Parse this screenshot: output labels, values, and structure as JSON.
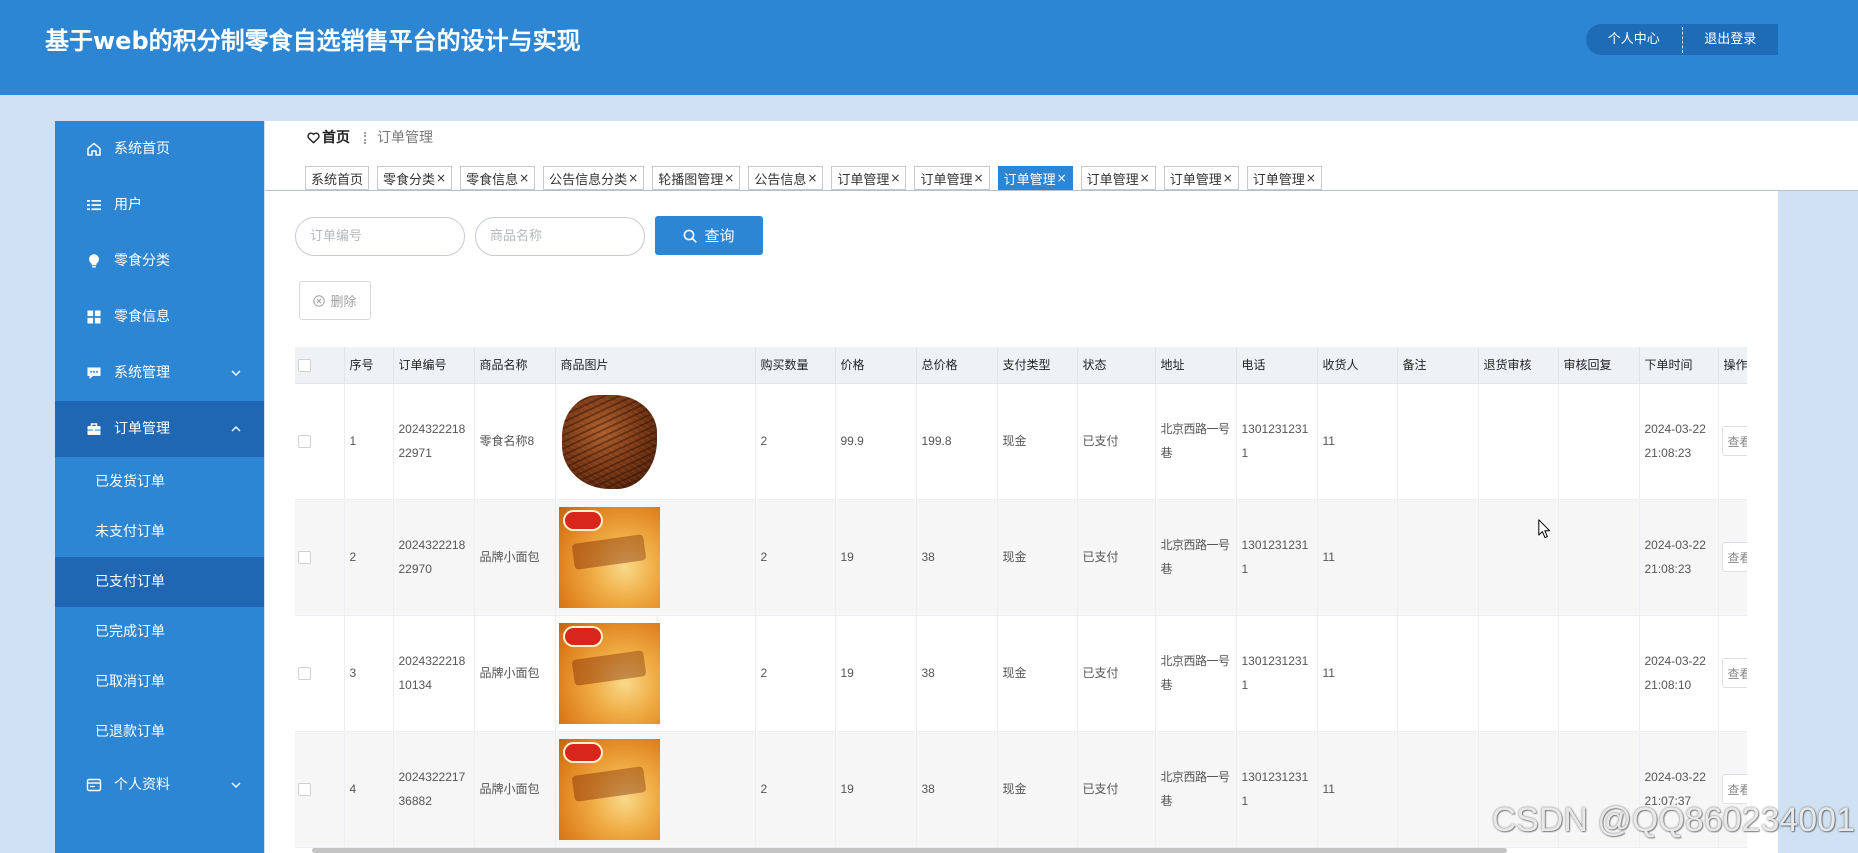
{
  "header": {
    "title": "基于web的积分制零食自选销售平台的设计与实现",
    "profile_label": "个人中心",
    "logout_label": "退出登录"
  },
  "sidebar": {
    "items": [
      {
        "label": "系统首页",
        "icon": "home-icon"
      },
      {
        "label": "用户",
        "icon": "list-icon"
      },
      {
        "label": "零食分类",
        "icon": "bulb-icon"
      },
      {
        "label": "零食信息",
        "icon": "grid-icon"
      },
      {
        "label": "系统管理",
        "icon": "chat-icon",
        "expandable": true,
        "expanded": false
      },
      {
        "label": "订单管理",
        "icon": "briefcase-icon",
        "expandable": true,
        "expanded": true,
        "active": true,
        "children": [
          {
            "label": "已发货订单"
          },
          {
            "label": "未支付订单"
          },
          {
            "label": "已支付订单",
            "active": true
          },
          {
            "label": "已完成订单"
          },
          {
            "label": "已取消订单"
          },
          {
            "label": "已退款订单"
          }
        ]
      },
      {
        "label": "个人资料",
        "icon": "id-card-icon",
        "expandable": true,
        "expanded": false
      }
    ]
  },
  "breadcrumb": {
    "home": "首页",
    "current": "订单管理"
  },
  "tabs": [
    {
      "label": "系统首页",
      "closable": false
    },
    {
      "label": "零食分类",
      "closable": true
    },
    {
      "label": "零食信息",
      "closable": true
    },
    {
      "label": "公告信息分类",
      "closable": true
    },
    {
      "label": "轮播图管理",
      "closable": true
    },
    {
      "label": "公告信息",
      "closable": true
    },
    {
      "label": "订单管理",
      "closable": true
    },
    {
      "label": "订单管理",
      "closable": true
    },
    {
      "label": "订单管理",
      "closable": true,
      "active": true
    },
    {
      "label": "订单管理",
      "closable": true
    },
    {
      "label": "订单管理",
      "closable": true
    },
    {
      "label": "订单管理",
      "closable": true
    }
  ],
  "search": {
    "order_no_placeholder": "订单编号",
    "product_name_placeholder": "商品名称",
    "query_label": "查询"
  },
  "actions": {
    "delete_label": "删除"
  },
  "table": {
    "columns": [
      "序号",
      "订单编号",
      "商品名称",
      "商品图片",
      "购买数量",
      "价格",
      "总价格",
      "支付类型",
      "状态",
      "地址",
      "电话",
      "收货人",
      "备注",
      "退货审核",
      "审核回复",
      "下单时间",
      "操作"
    ],
    "rows": [
      {
        "index": 1,
        "order_no": "202432221822971",
        "product_name": "零食名称8",
        "image": "beef-jerky",
        "quantity": 2,
        "price": 99.9,
        "total": 199.8,
        "payment_type": "现金",
        "status": "已支付",
        "address": "北京西路一号巷",
        "phone": "13012312311",
        "receiver": "11",
        "remark": "",
        "return_review": "",
        "review_reply": "",
        "order_time": "2024-03-22 21:08:23",
        "action_label": "查看"
      },
      {
        "index": 2,
        "order_no": "202432221822970",
        "product_name": "品牌小面包",
        "image": "bread-package",
        "quantity": 2,
        "price": 19,
        "total": 38,
        "payment_type": "现金",
        "status": "已支付",
        "address": "北京西路一号巷",
        "phone": "13012312311",
        "receiver": "11",
        "remark": "",
        "return_review": "",
        "review_reply": "",
        "order_time": "2024-03-22 21:08:23",
        "action_label": "查看"
      },
      {
        "index": 3,
        "order_no": "202432221810134",
        "product_name": "品牌小面包",
        "image": "bread-package",
        "quantity": 2,
        "price": 19,
        "total": 38,
        "payment_type": "现金",
        "status": "已支付",
        "address": "北京西路一号巷",
        "phone": "13012312311",
        "receiver": "11",
        "remark": "",
        "return_review": "",
        "review_reply": "",
        "order_time": "2024-03-22 21:08:10",
        "action_label": "查看"
      },
      {
        "index": 4,
        "order_no": "202432221736882",
        "product_name": "品牌小面包",
        "image": "bread-package",
        "quantity": 2,
        "price": 19,
        "total": 38,
        "payment_type": "现金",
        "status": "已支付",
        "address": "北京西路一号巷",
        "phone": "13012312311",
        "receiver": "11",
        "remark": "",
        "return_review": "",
        "review_reply": "",
        "order_time": "2024-03-22 21:07:37",
        "action_label": "查看"
      }
    ]
  },
  "watermark": "CSDN @QQ860234001",
  "colors": {
    "primary": "#2d86d4",
    "primary_dark": "#1f67b3",
    "page_background": "#cfe1f2",
    "header_button": "#1e6cb8",
    "striped_row": "#f6f6f6"
  }
}
